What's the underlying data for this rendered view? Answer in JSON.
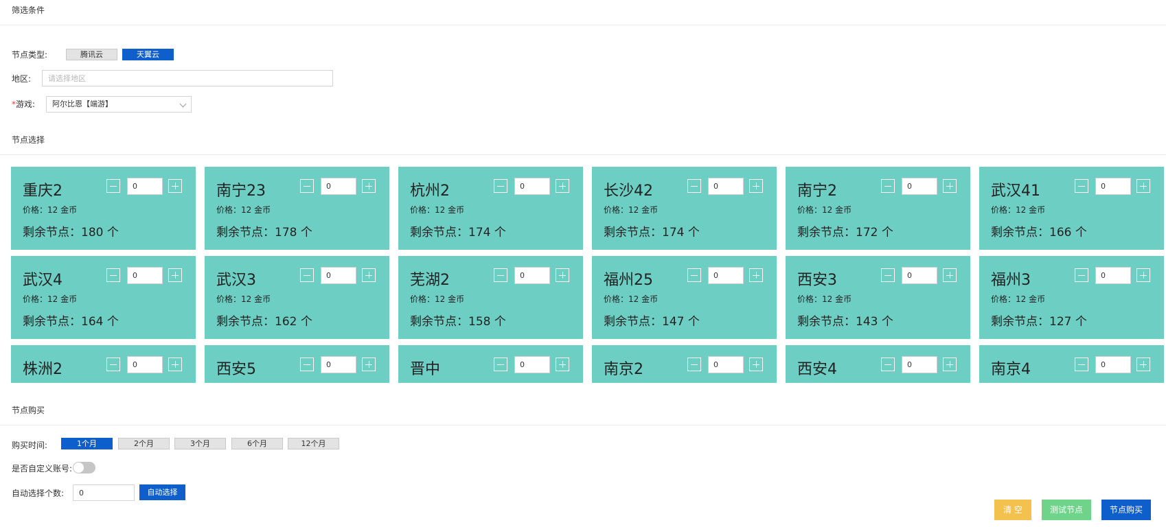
{
  "filter": {
    "title": "筛选条件",
    "node_type_label": "节点类型:",
    "node_types": [
      {
        "label": "腾讯云",
        "active": false
      },
      {
        "label": "天翼云",
        "active": true
      }
    ],
    "region_label": "地区:",
    "region_placeholder": "请选择地区",
    "game_required_mark": "*",
    "game_label": "游戏:",
    "game_value": "阿尔比恩【端游】"
  },
  "node_select": {
    "title": "节点选择",
    "price_prefix": "价格：",
    "remain_prefix": "剩余节点：",
    "nodes": [
      {
        "name": "重庆2",
        "price": "12 金币",
        "remaining": "180 个",
        "qty": "0"
      },
      {
        "name": "南宁23",
        "price": "12 金币",
        "remaining": "178 个",
        "qty": "0"
      },
      {
        "name": "杭州2",
        "price": "12 金币",
        "remaining": "174 个",
        "qty": "0"
      },
      {
        "name": "长沙42",
        "price": "12 金币",
        "remaining": "174 个",
        "qty": "0"
      },
      {
        "name": "南宁2",
        "price": "12 金币",
        "remaining": "172 个",
        "qty": "0"
      },
      {
        "name": "武汉41",
        "price": "12 金币",
        "remaining": "166 个",
        "qty": "0"
      },
      {
        "name": "武汉4",
        "price": "12 金币",
        "remaining": "164 个",
        "qty": "0"
      },
      {
        "name": "武汉3",
        "price": "12 金币",
        "remaining": "162 个",
        "qty": "0"
      },
      {
        "name": "芜湖2",
        "price": "12 金币",
        "remaining": "158 个",
        "qty": "0"
      },
      {
        "name": "福州25",
        "price": "12 金币",
        "remaining": "147 个",
        "qty": "0"
      },
      {
        "name": "西安3",
        "price": "12 金币",
        "remaining": "143 个",
        "qty": "0"
      },
      {
        "name": "福州3",
        "price": "12 金币",
        "remaining": "127 个",
        "qty": "0"
      },
      {
        "name": "株洲2",
        "qty": "0"
      },
      {
        "name": "西安5",
        "qty": "0"
      },
      {
        "name": "晋中",
        "qty": "0"
      },
      {
        "name": "南京2",
        "qty": "0"
      },
      {
        "name": "西安4",
        "qty": "0"
      },
      {
        "name": "南京4",
        "qty": "0"
      }
    ]
  },
  "purchase": {
    "title": "节点购买",
    "time_label": "购买时间:",
    "durations": [
      {
        "label": "1个月",
        "active": true
      },
      {
        "label": "2个月",
        "active": false
      },
      {
        "label": "3个月",
        "active": false
      },
      {
        "label": "6个月",
        "active": false
      },
      {
        "label": "12个月",
        "active": false
      }
    ],
    "custom_account_label": "是否自定义账号:",
    "custom_account_enabled": false,
    "auto_count_label": "自动选择个数:",
    "auto_count_value": "0",
    "auto_select_label": "自动选择"
  },
  "actions": {
    "clear_label": "清 空",
    "clear_color": "#f2c14e",
    "test_label": "测试节点",
    "test_color": "#6fd38a",
    "buy_label": "节点购买",
    "buy_color": "#0e5fcc"
  }
}
